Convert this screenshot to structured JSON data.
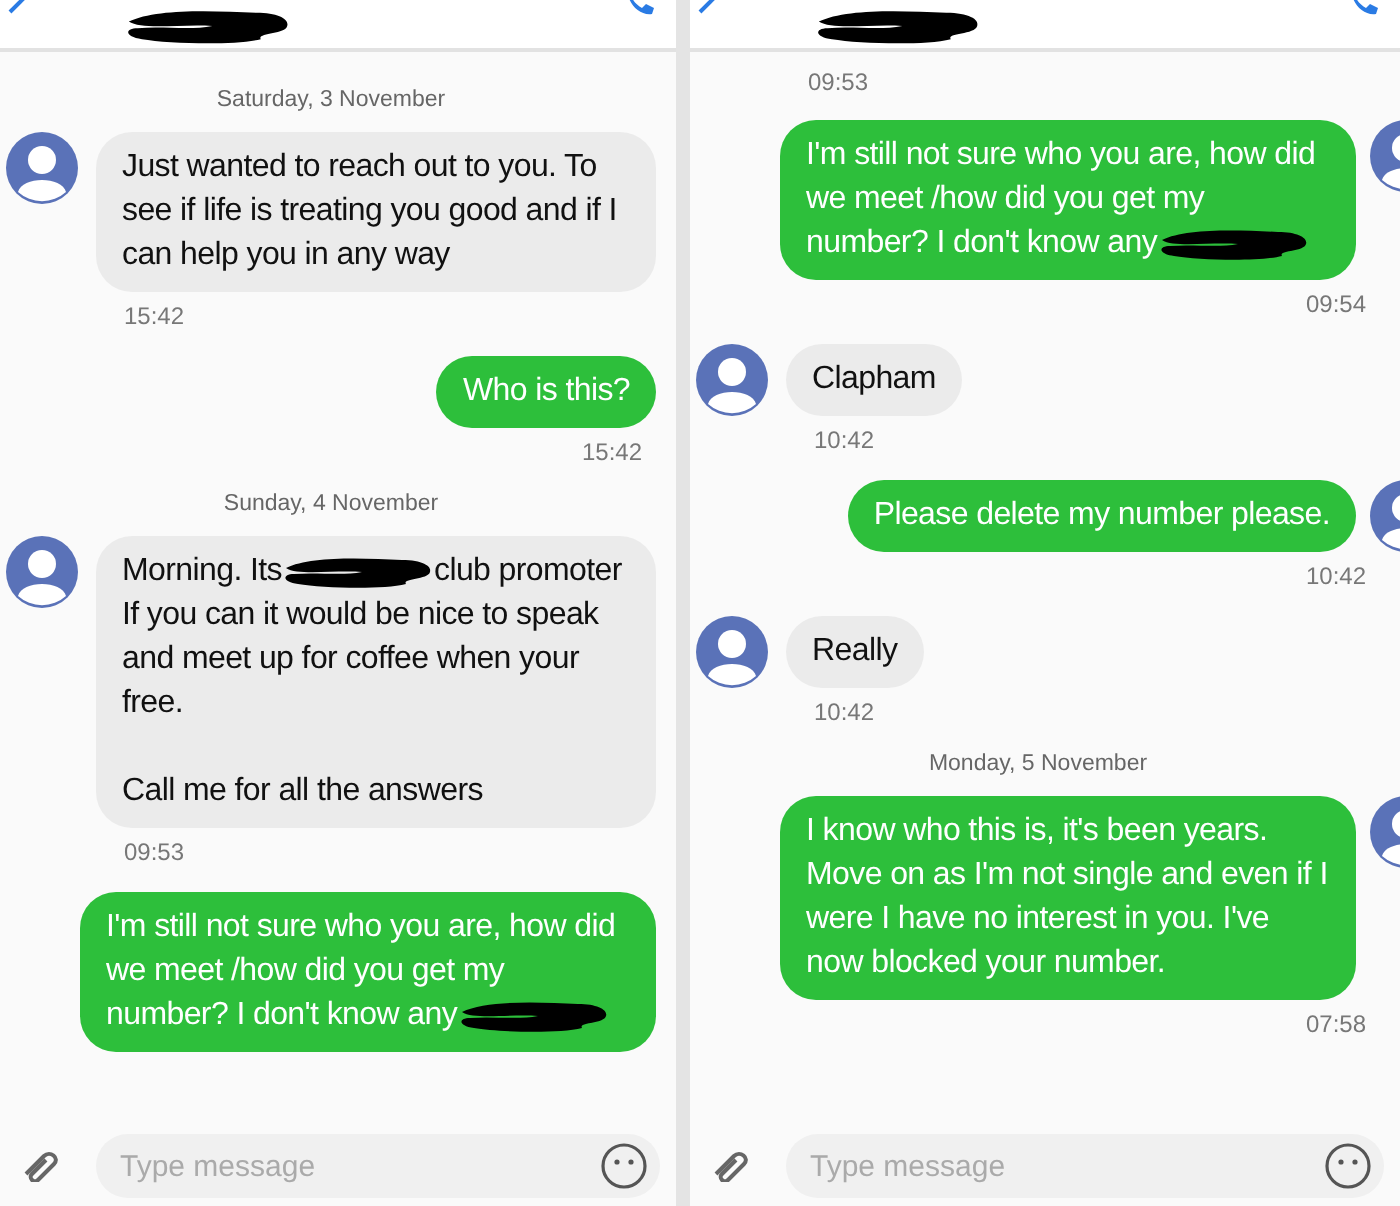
{
  "panels": [
    {
      "items": [
        {
          "kind": "date",
          "text": "Saturday, 3 November"
        },
        {
          "kind": "message",
          "outgoing": false,
          "show_avatar": true,
          "parts": [
            {
              "kind": "text",
              "text": "Just wanted to reach out to you. To see if life is treating you good and if I can help you in any way"
            }
          ],
          "time": "15:42"
        },
        {
          "kind": "message",
          "outgoing": true,
          "show_avatar": false,
          "parts": [
            {
              "kind": "text",
              "text": "Who is this?"
            }
          ],
          "time": "15:42"
        },
        {
          "kind": "date",
          "text": "Sunday, 4 November"
        },
        {
          "kind": "message",
          "outgoing": false,
          "show_avatar": true,
          "parts": [
            {
              "kind": "text",
              "text": "Morning.  Its"
            },
            {
              "kind": "redaction"
            },
            {
              "kind": "text",
              "text": "club promoter"
            },
            {
              "kind": "paragraph",
              "text": "If you can it would be nice to speak and meet up for coffee when your free.\n\nCall me for all the answers"
            }
          ],
          "time": "09:53"
        },
        {
          "kind": "message",
          "outgoing": true,
          "show_avatar": false,
          "parts": [
            {
              "kind": "paragraph",
              "text": "I'm still not sure who you are, how did we meet /how did you get my"
            },
            {
              "kind": "text",
              "text": "number? I don't know any"
            },
            {
              "kind": "redaction"
            }
          ]
        }
      ],
      "composer": {
        "placeholder": "Type message"
      }
    },
    {
      "items": [
        {
          "kind": "time",
          "text": "09:53"
        },
        {
          "kind": "message",
          "outgoing": true,
          "show_avatar": true,
          "parts": [
            {
              "kind": "paragraph",
              "text": "I'm still not sure who you are, how did we meet /how did you get my"
            },
            {
              "kind": "text",
              "text": "number? I don't know any"
            },
            {
              "kind": "redaction"
            }
          ],
          "time": "09:54"
        },
        {
          "kind": "message",
          "outgoing": false,
          "show_avatar": true,
          "parts": [
            {
              "kind": "text",
              "text": "Clapham"
            }
          ],
          "time": "10:42"
        },
        {
          "kind": "message",
          "outgoing": true,
          "show_avatar": true,
          "parts": [
            {
              "kind": "text",
              "text": "Please delete my number please."
            }
          ],
          "time": "10:42"
        },
        {
          "kind": "message",
          "outgoing": false,
          "show_avatar": true,
          "parts": [
            {
              "kind": "text",
              "text": "Really"
            }
          ],
          "time": "10:42"
        },
        {
          "kind": "date",
          "text": "Monday, 5 November"
        },
        {
          "kind": "message",
          "outgoing": true,
          "show_avatar": true,
          "parts": [
            {
              "kind": "text",
              "text": "I know who this is, it's been years. Move on as I'm not single and even if I were I have no interest in you. I've now blocked your number."
            }
          ],
          "time": "07:58"
        }
      ],
      "composer": {
        "placeholder": "Type message"
      }
    }
  ]
}
